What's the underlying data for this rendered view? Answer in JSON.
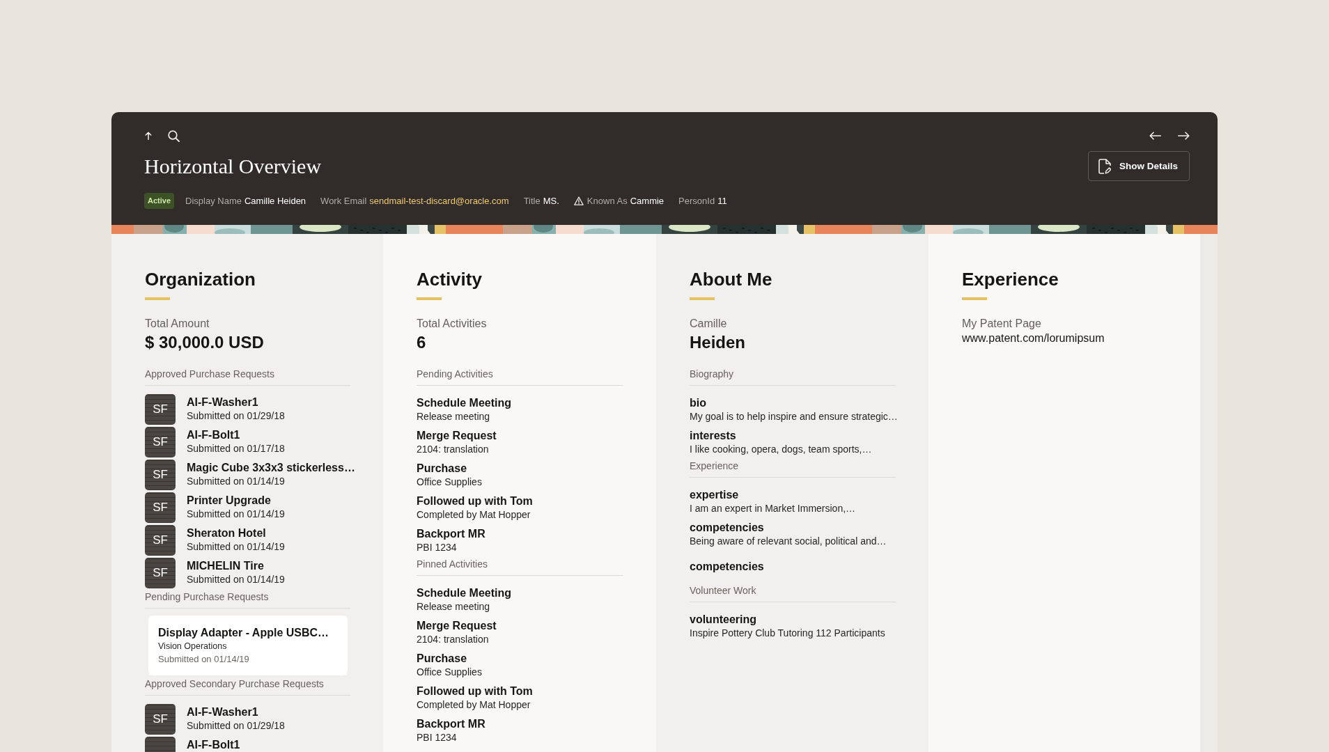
{
  "header": {
    "title": "Horizontal Overview",
    "status": {
      "label": "Active"
    },
    "fields": [
      {
        "label": "Display Name",
        "value": "Camille Heiden",
        "kind": "text",
        "warning": false
      },
      {
        "label": "Work Email",
        "value": "sendmail-test-discard@oracle.com",
        "kind": "email",
        "warning": false
      },
      {
        "label": "Title",
        "value": "MS.",
        "kind": "text",
        "warning": false
      },
      {
        "label": "Known As",
        "value": "Cammie",
        "kind": "text",
        "warning": true
      },
      {
        "label": "PersonId",
        "value": "11",
        "kind": "text",
        "warning": false
      }
    ],
    "actions": [
      {
        "label": "Show Details"
      }
    ]
  },
  "columns": [
    {
      "heading": "Organization",
      "summary": {
        "kind": "metric",
        "label": "Total Amount",
        "value": "$ 30,000.0 USD"
      },
      "sections": [
        {
          "label": "Approved Purchase Requests",
          "items": [
            {
              "kind": "avatar",
              "initials": "SF",
              "title": "AI-F-Washer1",
              "subtitle": "Submitted on 01/29/18"
            },
            {
              "kind": "avatar",
              "initials": "SF",
              "title": "AI-F-Bolt1",
              "subtitle": "Submitted on 01/17/18"
            },
            {
              "kind": "avatar",
              "initials": "SF",
              "title": "Magic Cube 3x3x3 stickerless…",
              "subtitle": "Submitted on 01/14/19"
            },
            {
              "kind": "avatar",
              "initials": "SF",
              "title": "Printer Upgrade",
              "subtitle": "Submitted on 01/14/19"
            },
            {
              "kind": "avatar",
              "initials": "SF",
              "title": "Sheraton Hotel",
              "subtitle": "Submitted on 01/14/19"
            },
            {
              "kind": "avatar",
              "initials": "SF",
              "title": "MICHELIN Tire",
              "subtitle": "Submitted on 01/14/19"
            }
          ]
        },
        {
          "label": "Pending Purchase Requests",
          "items": [
            {
              "kind": "card",
              "title": "Display Adapter - Apple USBC…",
              "subtitle": "Vision Operations",
              "meta": "Submitted on 01/14/19"
            }
          ]
        },
        {
          "label": "Approved Secondary Purchase Requests",
          "items": [
            {
              "kind": "avatar",
              "initials": "SF",
              "title": "AI-F-Washer1",
              "subtitle": "Submitted on 01/29/18"
            },
            {
              "kind": "avatar",
              "title": "AI-F-Bolt1"
            }
          ]
        }
      ]
    },
    {
      "heading": "Activity",
      "summary": {
        "kind": "metric",
        "label": "Total Activities",
        "value": "6"
      },
      "sections": [
        {
          "label": "Pending Activities",
          "items": [
            {
              "kind": "plain",
              "title": "Schedule Meeting",
              "subtitle": "Release meeting"
            },
            {
              "kind": "plain",
              "title": "Merge Request",
              "subtitle": "2104: translation"
            },
            {
              "kind": "plain",
              "title": "Purchase",
              "subtitle": "Office Supplies"
            },
            {
              "kind": "plain",
              "title": "Followed up with Tom",
              "subtitle": "Completed by Mat Hopper"
            },
            {
              "kind": "plain",
              "title": "Backport MR",
              "subtitle": "PBI 1234"
            }
          ]
        },
        {
          "label": "Pinned Activities",
          "items": [
            {
              "kind": "plain",
              "title": "Schedule Meeting",
              "subtitle": "Release meeting"
            },
            {
              "kind": "plain",
              "title": "Merge Request",
              "subtitle": "2104: translation"
            },
            {
              "kind": "plain",
              "title": "Purchase",
              "subtitle": "Office Supplies"
            },
            {
              "kind": "plain",
              "title": "Followed up with Tom",
              "subtitle": "Completed by Mat Hopper"
            },
            {
              "kind": "plain",
              "title": "Backport MR",
              "subtitle": "PBI 1234"
            }
          ]
        }
      ]
    },
    {
      "heading": "About Me",
      "summary": {
        "kind": "metric",
        "label": "Camille",
        "value": "Heiden"
      },
      "sections": [
        {
          "label": "Biography",
          "items": [
            {
              "kind": "plain",
              "title": "bio",
              "subtitle": "My goal is to help inspire and ensure strategic…"
            },
            {
              "kind": "plain",
              "title": "interests",
              "subtitle": "I like cooking, opera, dogs, team sports,…"
            }
          ]
        },
        {
          "label": "Experience",
          "items": [
            {
              "kind": "plain",
              "title": "expertise",
              "subtitle": "I am an expert in Market Immersion,…"
            },
            {
              "kind": "plain",
              "title": "competencies",
              "subtitle": "Being aware of relevant social, political and…"
            },
            {
              "kind": "plain",
              "title": "competencies"
            }
          ]
        },
        {
          "label": "Volunteer Work",
          "items": [
            {
              "kind": "plain",
              "title": "volunteering",
              "subtitle": "Inspire Pottery Club Tutoring 112 Participants"
            }
          ]
        }
      ]
    },
    {
      "heading": "Experience",
      "summary": {
        "kind": "text",
        "label": "My Patent Page",
        "value": "www.patent.com/lorumipsum"
      }
    }
  ]
}
